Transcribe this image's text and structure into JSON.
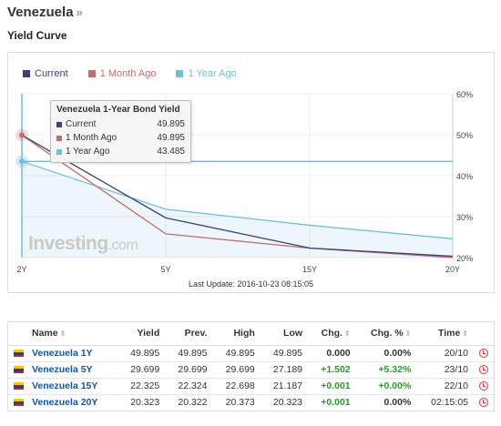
{
  "page": {
    "title": "Venezuela",
    "title_chevron": "»",
    "section": "Yield Curve"
  },
  "legend": [
    {
      "label": "Current",
      "color": "#3b3f7a"
    },
    {
      "label": "1 Month Ago",
      "color": "#c0706a"
    },
    {
      "label": "1 Year Ago",
      "color": "#6fbfdc"
    }
  ],
  "chart_data": {
    "type": "line",
    "categories": [
      "2Y",
      "5Y",
      "15Y",
      "20Y"
    ],
    "y_ticks": [
      "60%",
      "50%",
      "40%",
      "30%",
      "20%"
    ],
    "ylim": [
      20,
      60
    ],
    "series": [
      {
        "name": "Current",
        "color": "#3b3f7a",
        "values": [
          49.895,
          29.699,
          22.325,
          20.323
        ]
      },
      {
        "name": "1 Month Ago",
        "color": "#c0706a",
        "values": [
          49.895,
          25.8,
          22.3,
          20.0
        ]
      },
      {
        "name": "1 Year Ago",
        "color": "#6fbfdc",
        "values": [
          43.485,
          31.8,
          27.9,
          24.6
        ]
      }
    ],
    "reference_line": 43.485,
    "grid": true
  },
  "tooltip": {
    "title": "Venezuela 1-Year Bond Yield",
    "rows": [
      {
        "name": "Current",
        "value": "49.895",
        "color": "#3b3f7a"
      },
      {
        "name": "1 Month Ago",
        "value": "49.895",
        "color": "#c0706a"
      },
      {
        "name": "1 Year Ago",
        "value": "43.485",
        "color": "#6fbfdc"
      }
    ]
  },
  "watermark": {
    "brand": "Investing",
    "suffix": ".com"
  },
  "last_update": "Last Update: 2016-10-23 08:15:05",
  "table": {
    "headers": {
      "name": "Name",
      "yield": "Yield",
      "prev": "Prev.",
      "high": "High",
      "low": "Low",
      "chg": "Chg.",
      "chg_pct": "Chg. %",
      "time": "Time"
    },
    "rows": [
      {
        "name": "Venezuela 1Y",
        "yield": "49.895",
        "prev": "49.895",
        "high": "49.895",
        "low": "49.895",
        "chg": "0.000",
        "chg_pct": "0.00%",
        "time": "20/10"
      },
      {
        "name": "Venezuela 5Y",
        "yield": "29.699",
        "prev": "29.699",
        "high": "29.699",
        "low": "27.189",
        "chg": "+1.502",
        "chg_pct": "+5.32%",
        "time": "23/10"
      },
      {
        "name": "Venezuela 15Y",
        "yield": "22.325",
        "prev": "22.324",
        "high": "22.698",
        "low": "21.187",
        "chg": "+0.001",
        "chg_pct": "+0.00%",
        "time": "22/10"
      },
      {
        "name": "Venezuela 20Y",
        "yield": "20.323",
        "prev": "20.322",
        "high": "20.373",
        "low": "20.323",
        "chg": "+0.001",
        "chg_pct": "0.00%",
        "time": "02:15:05"
      }
    ]
  }
}
